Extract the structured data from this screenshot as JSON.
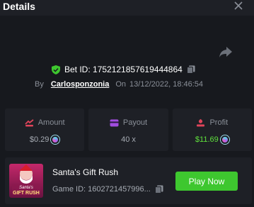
{
  "header": {
    "title": "Details"
  },
  "bet": {
    "id_text": "Bet ID: 1752121857619444864",
    "by_label": "By",
    "username": "Carlosponzonia",
    "on_label": "On",
    "datetime": "13/12/2022, 18:46:54"
  },
  "stats": {
    "amount": {
      "label": "Amount",
      "value": "$0.29"
    },
    "payout": {
      "label": "Payout",
      "value": "40 x"
    },
    "profit": {
      "label": "Profit",
      "value": "$11.69"
    }
  },
  "game": {
    "name": "Santa's Gift Rush",
    "id_text": "Game ID: 1602721457996...",
    "thumb_text": "Santa's GIFT RUSH",
    "play_label": "Play Now"
  },
  "colors": {
    "background": "#17191e",
    "card": "#1e2026",
    "accent_green": "#3ec72f",
    "profit_green": "#5fe03c",
    "amount_icon": "#e0445a",
    "payout_icon": "#a24de0",
    "profit_icon": "#e0445a"
  },
  "icons": [
    "close-icon",
    "share-icon",
    "verified-shield-icon",
    "copy-icon",
    "amount-icon",
    "payout-icon",
    "profit-icon",
    "coin-icon"
  ]
}
